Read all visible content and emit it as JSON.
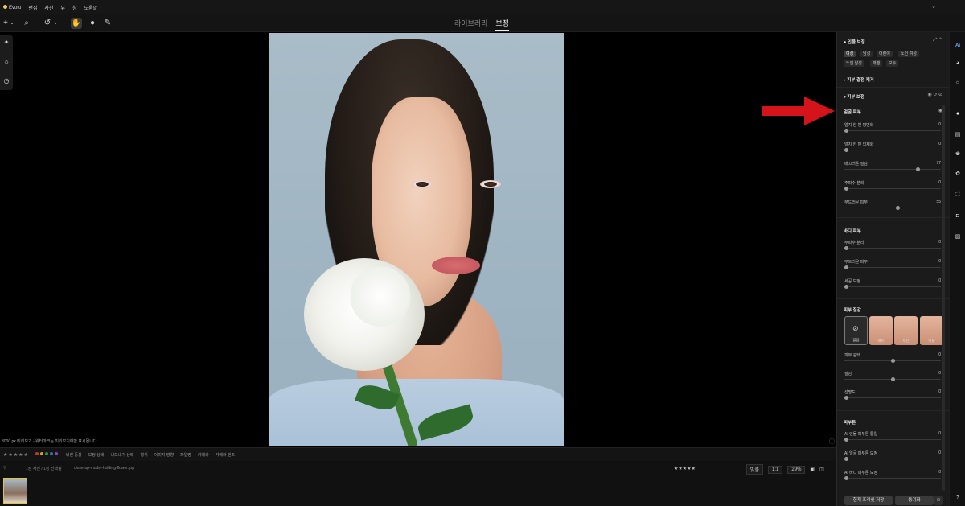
{
  "menu": {
    "app": "Evoto",
    "items": [
      "편집",
      "사진",
      "뷰",
      "창",
      "도움말"
    ]
  },
  "mode_tabs": {
    "library": "라이브러리",
    "retouch": "보정"
  },
  "status": {
    "preview_note": "3000 px 미리보기 - 워터마크는 미리보기에만 표시됩니다."
  },
  "filmbar": {
    "rating_label": "★★★★★",
    "labels": [
      "버전 동봉",
      "보정 상태",
      "내보내기 상태",
      "형식",
      "이미지 방향",
      "파일명",
      "카메라",
      "카메라 렌즈"
    ]
  },
  "infobar": {
    "count": "1장 사진 / 1장 선택됨",
    "filename": "close-up-model-holding-flower.jpg",
    "fit": "맞춤",
    "ratio": "1:1",
    "zoom": "29%"
  },
  "panel": {
    "portrait_title": "인물 보정",
    "chips": [
      "여성",
      "남성",
      "어린이",
      "노인 여성",
      "노인 남성",
      "개별",
      "모두"
    ],
    "blemish": "피부 결점 제거",
    "skin_section": "피부 보정",
    "face_skin": "얼굴 피부",
    "face_rows": [
      {
        "label": "얼지 한 번 평면화",
        "value": "0",
        "pct": 0
      },
      {
        "label": "얼지 한 번 입체화",
        "value": "0",
        "pct": 0
      },
      {
        "label": "매끄러운 질감",
        "value": "77",
        "pct": 77
      },
      {
        "label": "주파수 분리",
        "value": "0",
        "pct": 0
      },
      {
        "label": "부드러운 피부",
        "value": "55",
        "pct": 55
      }
    ],
    "body_skin": "바디 피부",
    "body_rows": [
      {
        "label": "주파수 분리",
        "value": "0",
        "pct": 0
      },
      {
        "label": "부드러운 피부",
        "value": "0",
        "pct": 0
      },
      {
        "label": "세공 보정",
        "value": "0",
        "pct": 0
      }
    ],
    "texture": "피부 질감",
    "tex_items": [
      "없음",
      "매트",
      "새틴",
      "이슬"
    ],
    "tex_rows": [
      {
        "label": "피부 광택",
        "value": "0",
        "pct": 50
      },
      {
        "label": "질감",
        "value": "0",
        "pct": 50
      },
      {
        "label": "선명도",
        "value": "0",
        "pct": 0
      }
    ],
    "skin_tone": "피부톤",
    "tone_rows": [
      {
        "label": "AI 인물 피부톤 통일",
        "value": "0",
        "pct": 0
      },
      {
        "label": "AI 얼굴 피부톤 보정",
        "value": "0",
        "pct": 0
      },
      {
        "label": "AI 바디 피부톤 보정",
        "value": "0",
        "pct": 0
      }
    ],
    "save_preset": "현재 프리셋 저장",
    "sync": "동기화"
  },
  "colors": {
    "accent": "#e5c23a",
    "arrow": "#d4141a",
    "panel_bg": "#1b1b1b"
  }
}
